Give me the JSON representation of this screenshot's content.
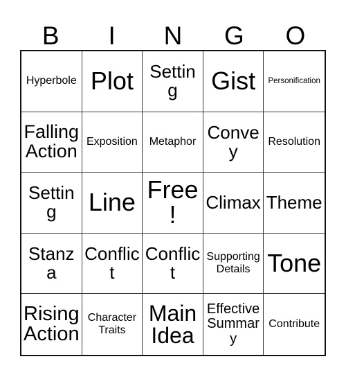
{
  "card": {
    "title": "BINGO",
    "free_space_label": "Free!",
    "border_color": "#111111",
    "grid_line_color": "#3a3a3a",
    "text_color": "#000000",
    "background_color": "#ffffff"
  },
  "header": {
    "letters": [
      {
        "label": "B"
      },
      {
        "label": "I"
      },
      {
        "label": "N"
      },
      {
        "label": "G"
      },
      {
        "label": "O"
      }
    ]
  },
  "grid": {
    "rows": 5,
    "columns": 5,
    "cells": [
      {
        "label": "Hyperbole",
        "size": "size-sm",
        "free": false
      },
      {
        "label": "Plot",
        "size": "size-xxl",
        "free": false
      },
      {
        "label": "Setting",
        "size": "size-lg",
        "free": false
      },
      {
        "label": "Gist",
        "size": "size-xxl",
        "free": false
      },
      {
        "label": "Personification",
        "size": "size-xs",
        "free": false
      },
      {
        "label": "Falling Action",
        "size": "size-xl",
        "free": false
      },
      {
        "label": "Exposition",
        "size": "size-sm",
        "free": false
      },
      {
        "label": "Metaphor",
        "size": "size-sm",
        "free": false
      },
      {
        "label": "Convey",
        "size": "size-lg",
        "free": false
      },
      {
        "label": "Resolution",
        "size": "size-sm",
        "free": false
      },
      {
        "label": "Setting",
        "size": "size-lg",
        "free": false
      },
      {
        "label": "Line",
        "size": "size-xxl",
        "free": false
      },
      {
        "label": "Free!",
        "size": "size-xxl",
        "free": true
      },
      {
        "label": "Climax",
        "size": "size-lg",
        "free": false
      },
      {
        "label": "Theme",
        "size": "size-lg",
        "free": false
      },
      {
        "label": "Stanza",
        "size": "size-lg",
        "free": false
      },
      {
        "label": "Conflict",
        "size": "size-lg",
        "free": false
      },
      {
        "label": "Conflict",
        "size": "size-lg",
        "free": false
      },
      {
        "label": "Supporting Details",
        "size": "size-sm",
        "free": false
      },
      {
        "label": "Tone",
        "size": "size-xxl",
        "free": false
      },
      {
        "label": "Rising Action",
        "size": "size-xl",
        "free": false
      },
      {
        "label": "Character Traits",
        "size": "size-sm",
        "free": false
      },
      {
        "label": "Main Idea",
        "size": "size-xl",
        "free": false
      },
      {
        "label": "Effective Summary",
        "size": "size-md",
        "free": false
      },
      {
        "label": "Contribute",
        "size": "size-sm",
        "free": false
      }
    ]
  }
}
